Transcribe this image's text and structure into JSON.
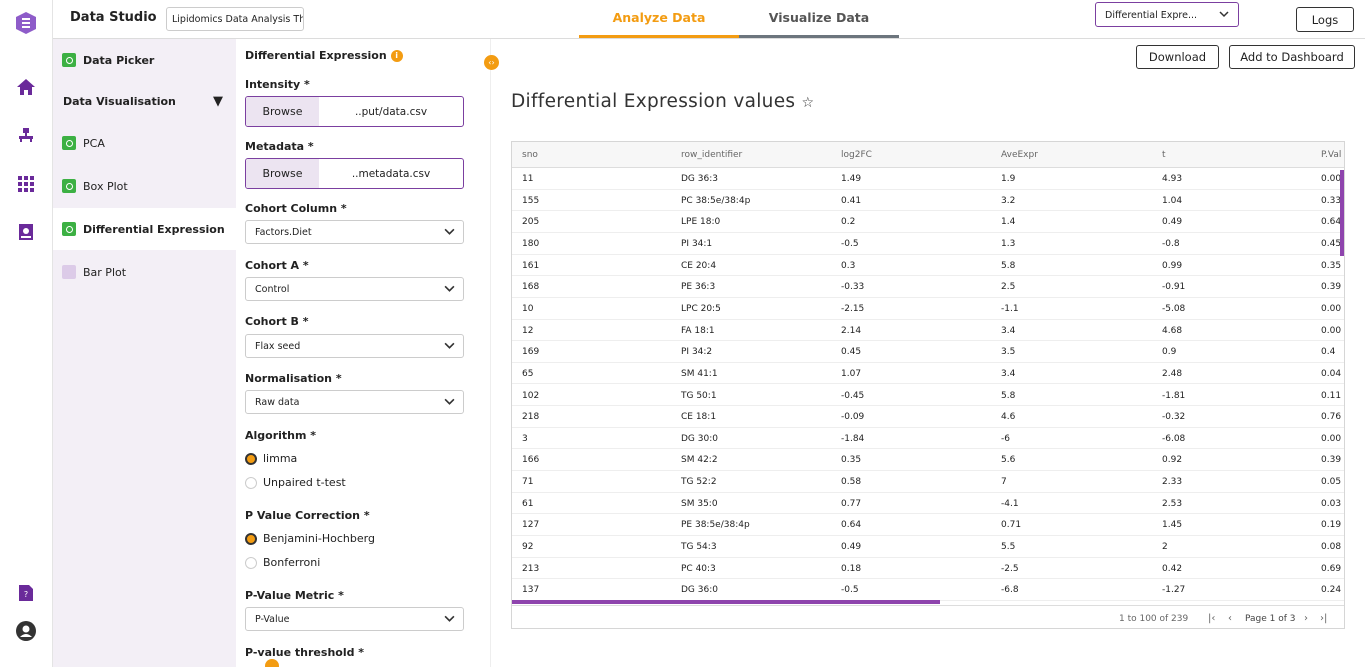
{
  "app": {
    "title": "Data Studio",
    "project_name": "Lipidomics Data Analysis Th"
  },
  "rail": {
    "icons": [
      "logo-icon",
      "home-icon",
      "workflow-icon",
      "apps-icon",
      "report-icon",
      "help-icon",
      "user-icon"
    ]
  },
  "tabs": [
    {
      "label": "Analyze Data",
      "active": true
    },
    {
      "label": "Visualize Data",
      "active": false
    }
  ],
  "header_select": {
    "value": "Differential Expre..."
  },
  "logs_label": "Logs",
  "sidebar": {
    "data_picker": "Data Picker",
    "section": "Data Visualisation",
    "items": [
      {
        "label": "PCA",
        "checked": true
      },
      {
        "label": "Box Plot",
        "checked": true
      },
      {
        "label": "Differential Expression",
        "checked": true
      },
      {
        "label": "Bar Plot",
        "checked": false
      }
    ]
  },
  "form": {
    "heading": "Differential Expression",
    "intensity": {
      "label": "Intensity *",
      "browse": "Browse",
      "file": "..put/data.csv"
    },
    "metadata": {
      "label": "Metadata *",
      "browse": "Browse",
      "file": "..metadata.csv"
    },
    "cohort_column": {
      "label": "Cohort Column *",
      "value": "Factors.Diet"
    },
    "cohort_a": {
      "label": "Cohort A *",
      "value": "Control"
    },
    "cohort_b": {
      "label": "Cohort B *",
      "value": "Flax seed"
    },
    "normalisation": {
      "label": "Normalisation *",
      "value": "Raw data"
    },
    "algorithm": {
      "label": "Algorithm *",
      "options": [
        "limma",
        "Unpaired t-test"
      ],
      "selected": "limma"
    },
    "p_value_correction": {
      "label": "P Value Correction *",
      "options": [
        "Benjamini-Hochberg",
        "Bonferroni"
      ],
      "selected": "Benjamini-Hochberg"
    },
    "p_value_metric": {
      "label": "P-Value Metric *",
      "value": "P-Value"
    },
    "p_value_threshold": {
      "label": "P-value threshold *"
    }
  },
  "toolbar": {
    "download": "Download",
    "add_dashboard": "Add to Dashboard"
  },
  "main_title": "Differential Expression values",
  "table": {
    "columns": [
      "sno",
      "row_identifier",
      "log2FC",
      "AveExpr",
      "t",
      "P.Val"
    ],
    "rows": [
      [
        "11",
        "DG 36:3",
        "1.49",
        "1.9",
        "4.93",
        "0.00"
      ],
      [
        "155",
        "PC 38:5e/38:4p",
        "0.41",
        "3.2",
        "1.04",
        "0.33"
      ],
      [
        "205",
        "LPE 18:0",
        "0.2",
        "1.4",
        "0.49",
        "0.64"
      ],
      [
        "180",
        "PI 34:1",
        "-0.5",
        "1.3",
        "-0.8",
        "0.45"
      ],
      [
        "161",
        "CE 20:4",
        "0.3",
        "5.8",
        "0.99",
        "0.35"
      ],
      [
        "168",
        "PE 36:3",
        "-0.33",
        "2.5",
        "-0.91",
        "0.39"
      ],
      [
        "10",
        "LPC 20:5",
        "-2.15",
        "-1.1",
        "-5.08",
        "0.00"
      ],
      [
        "12",
        "FA 18:1",
        "2.14",
        "3.4",
        "4.68",
        "0.00"
      ],
      [
        "169",
        "PI 34:2",
        "0.45",
        "3.5",
        "0.9",
        "0.4"
      ],
      [
        "65",
        "SM 41:1",
        "1.07",
        "3.4",
        "2.48",
        "0.04"
      ],
      [
        "102",
        "TG 50:1",
        "-0.45",
        "5.8",
        "-1.81",
        "0.11"
      ],
      [
        "218",
        "CE 18:1",
        "-0.09",
        "4.6",
        "-0.32",
        "0.76"
      ],
      [
        "3",
        "DG 30:0",
        "-1.84",
        "-6",
        "-6.08",
        "0.00"
      ],
      [
        "166",
        "SM 42:2",
        "0.35",
        "5.6",
        "0.92",
        "0.39"
      ],
      [
        "71",
        "TG 52:2",
        "0.58",
        "7",
        "2.33",
        "0.05"
      ],
      [
        "61",
        "SM 35:0",
        "0.77",
        "-4.1",
        "2.53",
        "0.03"
      ],
      [
        "127",
        "PE 38:5e/38:4p",
        "0.64",
        "0.71",
        "1.45",
        "0.19"
      ],
      [
        "92",
        "TG 54:3",
        "0.49",
        "5.5",
        "2",
        "0.08"
      ],
      [
        "213",
        "PC 40:3",
        "0.18",
        "-2.5",
        "0.42",
        "0.69"
      ],
      [
        "137",
        "DG 36:0",
        "-0.5",
        "-6.8",
        "-1.27",
        "0.24"
      ]
    ],
    "footer": {
      "range": "1 to 100 of 239",
      "page": "Page 1 of 3"
    }
  }
}
